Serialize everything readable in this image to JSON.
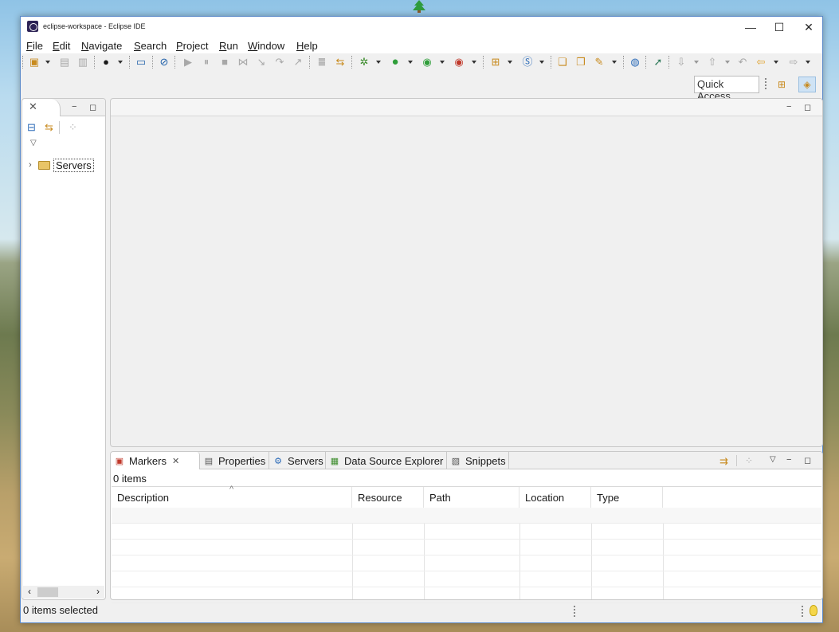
{
  "window": {
    "title": "eclipse-workspace - Eclipse IDE",
    "controls": {
      "minimize": "—",
      "maximize": "☐",
      "close": "✕"
    }
  },
  "menubar": {
    "items": [
      "File",
      "Edit",
      "Navigate",
      "Search",
      "Project",
      "Run",
      "Window",
      "Help"
    ]
  },
  "toolbar": {
    "quick_access_placeholder": "Quick Access"
  },
  "left_panel": {
    "tab_close": "✕",
    "minimize": "−",
    "maximize": "◻",
    "tree": [
      {
        "label": "Servers",
        "expanded": false
      }
    ],
    "scroll_left": "‹",
    "scroll_right": "›"
  },
  "editor_panel": {
    "minimize": "−",
    "maximize": "◻"
  },
  "bottom_panel": {
    "tabs": [
      {
        "label": "Markers",
        "active": true,
        "closable": true
      },
      {
        "label": "Properties",
        "active": false
      },
      {
        "label": "Servers",
        "active": false
      },
      {
        "label": "Data Source Explorer",
        "active": false
      },
      {
        "label": "Snippets",
        "active": false
      }
    ],
    "items_count": "0 items",
    "columns": [
      "Description",
      "Resource",
      "Path",
      "Location",
      "Type"
    ],
    "sort_indicator": "^",
    "minimize": "−",
    "maximize": "◻"
  },
  "statusbar": {
    "text": "0 items selected"
  },
  "colors": {
    "accent_border": "#5b8ac9",
    "folder": "#e9c567"
  }
}
